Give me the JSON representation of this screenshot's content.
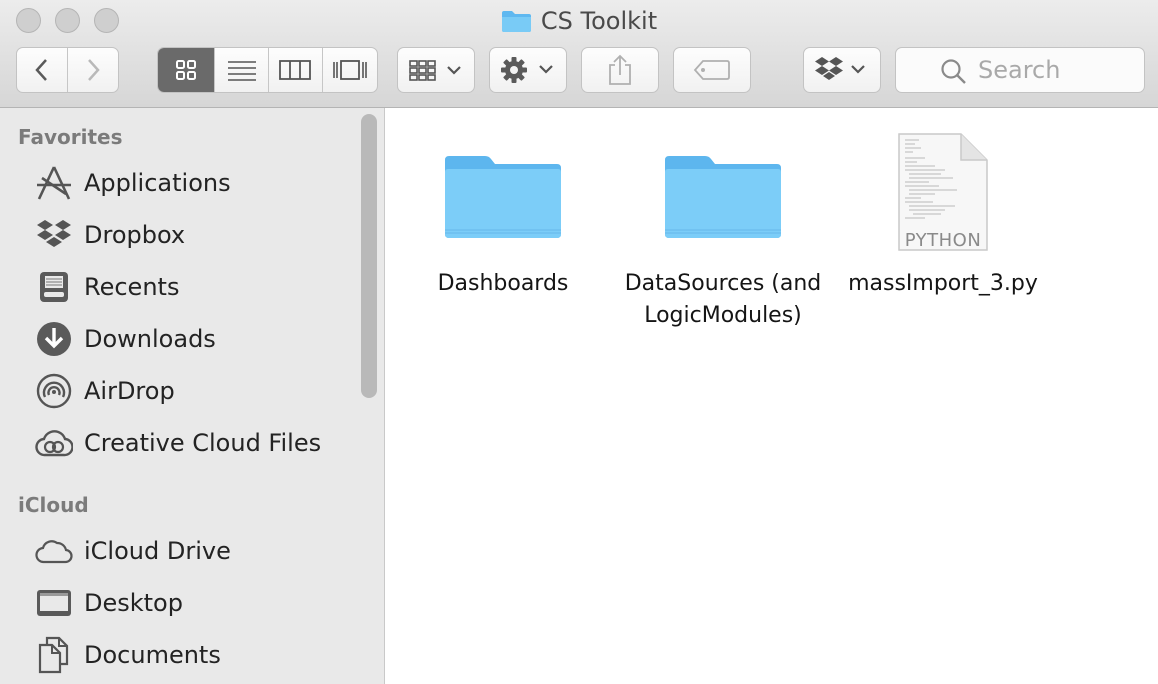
{
  "window": {
    "title": "CS Toolkit",
    "folder_color": "#5fb8f0"
  },
  "toolbar": {
    "back_icon": "chevron-left-icon",
    "forward_icon": "chevron-right-icon",
    "view_modes": [
      "icon-view-icon",
      "list-view-icon",
      "column-view-icon",
      "cover-flow-icon"
    ],
    "active_view": "icon-view-icon",
    "arrange_icon": "arrange-grid-icon",
    "action_icon": "gear-icon",
    "share_icon": "share-icon",
    "tag_icon": "tag-icon",
    "dropbox_icon": "dropbox-icon",
    "search_placeholder": "Search"
  },
  "sidebar": {
    "sections": [
      {
        "title": "Favorites",
        "items": [
          {
            "label": "Applications",
            "icon": "applications-icon"
          },
          {
            "label": "Dropbox",
            "icon": "dropbox-icon"
          },
          {
            "label": "Recents",
            "icon": "recents-icon"
          },
          {
            "label": "Downloads",
            "icon": "downloads-icon"
          },
          {
            "label": "AirDrop",
            "icon": "airdrop-icon"
          },
          {
            "label": "Creative Cloud Files",
            "icon": "creative-cloud-icon"
          }
        ]
      },
      {
        "title": "iCloud",
        "items": [
          {
            "label": "iCloud Drive",
            "icon": "cloud-icon"
          },
          {
            "label": "Desktop",
            "icon": "desktop-icon"
          },
          {
            "label": "Documents",
            "icon": "documents-icon"
          }
        ]
      }
    ]
  },
  "files": [
    {
      "line1": "Dashboards",
      "line2": "",
      "kind": "folder",
      "icon": "folder-icon"
    },
    {
      "line1": "DataSources (and",
      "line2": "LogicModules)",
      "kind": "folder",
      "icon": "folder-icon"
    },
    {
      "line1": "massImport_3.py",
      "line2": "",
      "kind": "python",
      "icon": "python-file-icon",
      "badge": "PYTHON"
    }
  ]
}
